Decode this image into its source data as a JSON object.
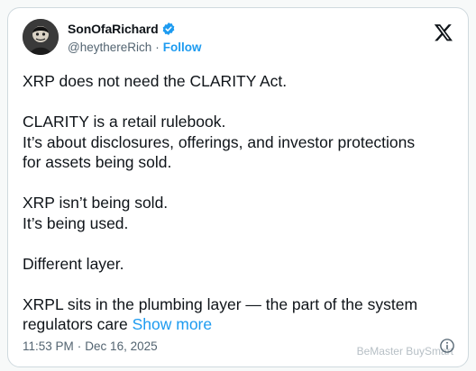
{
  "author": {
    "display_name": "SonOfaRichard",
    "handle": "@heythereRich",
    "separator": "·",
    "follow_label": "Follow",
    "verified_icon": "verified-badge-icon",
    "avatar_icon": "avatar"
  },
  "platform": {
    "logo_icon": "x-logo-icon"
  },
  "tweet": {
    "paragraphs": [
      {
        "lines": [
          "XRP does not need the CLARITY Act."
        ]
      },
      {
        "lines": [
          "CLARITY is a retail rulebook.",
          "It’s about disclosures, offerings, and investor protections",
          "for assets being sold."
        ]
      },
      {
        "lines": [
          "XRP isn’t being sold.",
          "It’s being used."
        ]
      },
      {
        "lines": [
          "Different layer."
        ]
      },
      {
        "lines": [
          "XRPL sits in the plumbing layer — the part of the system",
          "regulators care"
        ]
      }
    ],
    "show_more_label": "Show more"
  },
  "footer": {
    "time": "11:53 PM",
    "separator": "·",
    "date": "Dec 16, 2025",
    "info_icon": "info-icon"
  },
  "watermark": {
    "text": "BeMaster BuySmart"
  },
  "colors": {
    "accent": "#1d9bf0",
    "text": "#0f1419",
    "secondary": "#536471",
    "border": "#cfd9de"
  }
}
